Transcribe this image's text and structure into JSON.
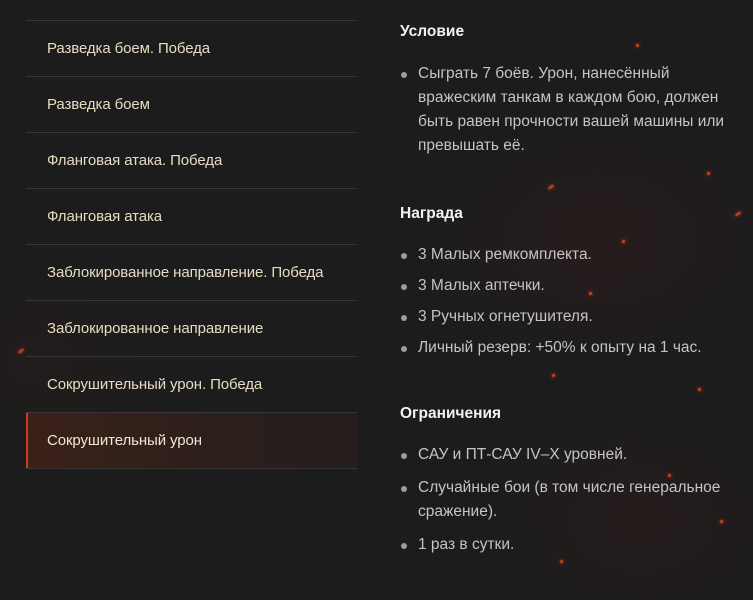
{
  "menu": {
    "items": [
      {
        "label": "Разведка боем. Победа",
        "active": false
      },
      {
        "label": "Разведка боем",
        "active": false
      },
      {
        "label": "Фланговая атака. Победа",
        "active": false
      },
      {
        "label": "Фланговая атака",
        "active": false
      },
      {
        "label": "Заблокированное направление. Победа",
        "active": false
      },
      {
        "label": "Заблокированное направление",
        "active": false
      },
      {
        "label": "Сокрушительный урон. Победа",
        "active": false
      },
      {
        "label": "Сокрушительный урон",
        "active": true
      }
    ]
  },
  "condition": {
    "title": "Условие",
    "items": [
      "Сыграть 7 боёв. Урон, нанесённый вражеским танкам в каждом бою, должен быть равен прочности вашей машины или превышать её."
    ]
  },
  "reward": {
    "title": "Награда",
    "items": [
      "3 Малых ремкомплекта.",
      "3 Малых аптечки.",
      "3 Ручных огнетушителя.",
      "Личный резерв: +50% к опыту на 1 час."
    ]
  },
  "restrictions": {
    "title": "Ограничения",
    "items": [
      "САУ и ПТ-САУ IV–X уровней.",
      "Случайные бои (в том числе генеральное сражение).",
      "1 раз в сутки."
    ]
  },
  "colors": {
    "background": "#1c1c1d",
    "accent": "#d13d1c",
    "menu_text": "#e6dcc1",
    "heading_text": "#f2f2f2",
    "body_text": "#c4c4c4"
  }
}
